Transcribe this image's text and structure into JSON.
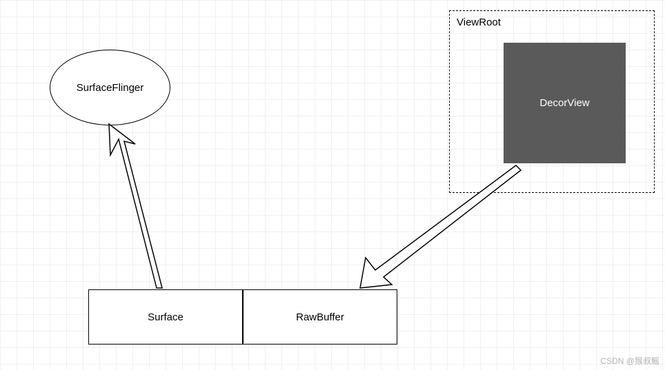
{
  "nodes": {
    "surfaceflinger": {
      "label": "SurfaceFlinger"
    },
    "viewroot": {
      "label": "ViewRoot"
    },
    "decorview": {
      "label": "DecorView"
    },
    "surface": {
      "label": "Surface"
    },
    "rawbuffer": {
      "label": "RawBuffer"
    }
  },
  "watermark": "CSDN @猴叔鳐"
}
